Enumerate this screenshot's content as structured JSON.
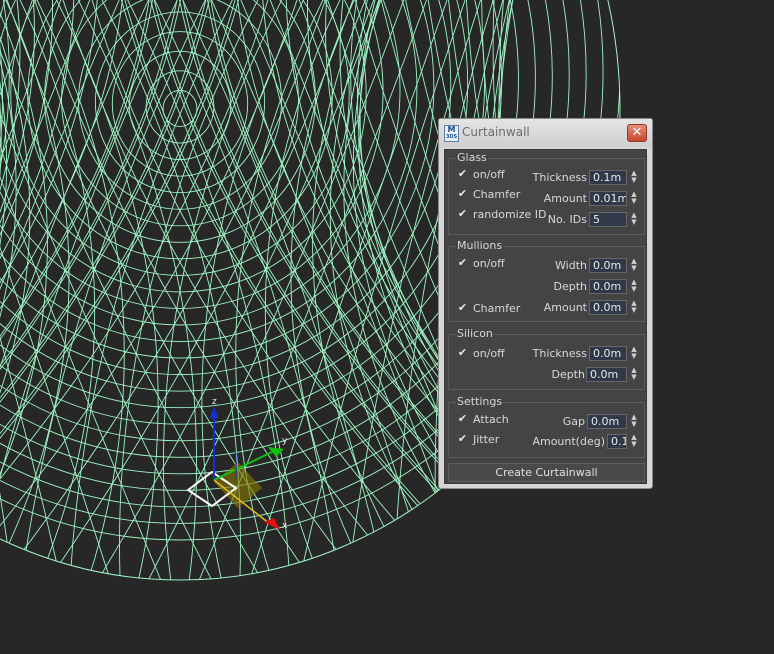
{
  "dialog": {
    "title": "Curtainwall",
    "app_icon_text": [
      "M",
      "3DS"
    ],
    "close_symbol": "✕",
    "check_glyph": "✔"
  },
  "glass": {
    "title": "Glass",
    "onoff_label": "on/off",
    "chamfer_label": "Chamfer",
    "randomize_label": "randomize ID",
    "thickness_label": "Thickness",
    "thickness_value": "0.1m",
    "amount_label": "Amount",
    "amount_value": "0.01m",
    "ids_label": "No. IDs",
    "ids_value": "5"
  },
  "mullions": {
    "title": "Mullions",
    "onoff_label": "on/off",
    "chamfer_label": "Chamfer",
    "width_label": "Width",
    "width_value": "0.0m",
    "depth_label": "Depth",
    "depth_value": "0.0m",
    "amount_label": "Amount",
    "amount_value": "0.0m"
  },
  "silicon": {
    "title": "Silicon",
    "onoff_label": "on/off",
    "thickness_label": "Thickness",
    "thickness_value": "0.0m",
    "depth_label": "Depth",
    "depth_value": "0.0m"
  },
  "settings": {
    "title": "Settings",
    "attach_label": "Attach",
    "jitter_label": "Jitter",
    "gap_label": "Gap",
    "gap_value": "0.0m",
    "amount_label": "Amount(deg)",
    "amount_value": "0.1"
  },
  "create_button_label": "Create Curtainwall",
  "gizmo": {
    "x_label": "x",
    "y_label": "y",
    "z_label": "z"
  },
  "colors": {
    "viewport_bg": "#272727",
    "wireframe": "#9ff5c6",
    "axis_x": "#e01010",
    "axis_y": "#10c010",
    "axis_z": "#1030e0",
    "plane_highlight": "#d8c000"
  }
}
